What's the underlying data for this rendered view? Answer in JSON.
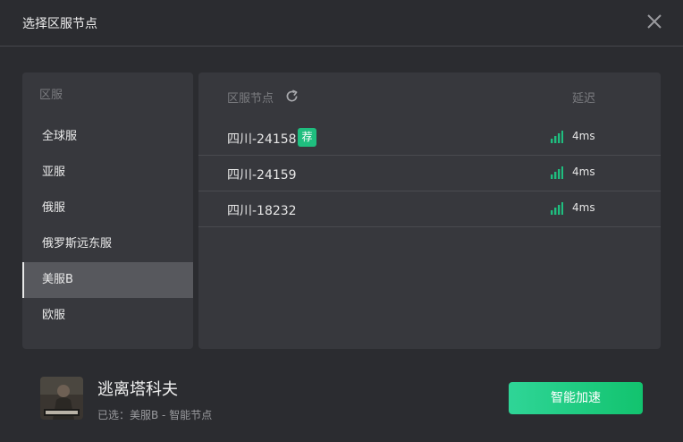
{
  "window": {
    "title": "选择区服节点"
  },
  "regions": {
    "header": "区服",
    "items": [
      {
        "label": "全球服"
      },
      {
        "label": "亚服"
      },
      {
        "label": "俄服"
      },
      {
        "label": "俄罗斯远东服"
      },
      {
        "label": "美服B",
        "active": true
      },
      {
        "label": "欧服"
      }
    ]
  },
  "nodes": {
    "header_name": "区服节点",
    "header_latency": "延迟",
    "items": [
      {
        "name": "四川-24158",
        "badge": "荐",
        "latency": "4ms"
      },
      {
        "name": "四川-24159",
        "latency": "4ms"
      },
      {
        "name": "四川-18232",
        "latency": "4ms"
      }
    ]
  },
  "footer": {
    "game_name": "逃离塔科夫",
    "selected_text": "已选：美服B - 智能节点",
    "accelerate_label": "智能加速"
  },
  "colors": {
    "accent_green": "#1fbe7f",
    "background": "#2b2c30",
    "panel": "#37383d",
    "active_row": "#57585d"
  }
}
